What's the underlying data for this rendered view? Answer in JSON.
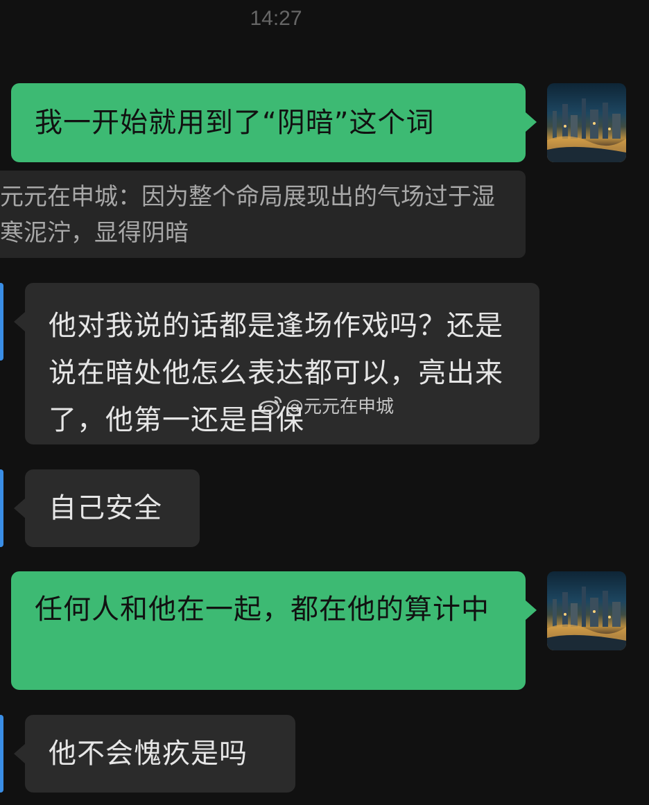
{
  "time": "14:27",
  "colors": {
    "background": "#111111",
    "outgoing_bubble": "#3dba73",
    "incoming_bubble": "#2b2b2b",
    "quote_background": "#262626",
    "avatar_edge": "#3a8ee6"
  },
  "messages": [
    {
      "direction": "outgoing",
      "text": "我一开始就用到了“阴暗”这个词"
    },
    {
      "direction": "quote",
      "text": "元元在申城：因为整个命局展现出的气场过于湿寒泥泞，显得阴暗"
    },
    {
      "direction": "incoming",
      "text": "他对我说的话都是逢场作戏吗？还是说在暗处他怎么表达都可以，亮出来了，他第一还是自保"
    },
    {
      "direction": "incoming",
      "text": "自己安全"
    },
    {
      "direction": "outgoing",
      "text": "任何人和他在一起，都在他的算计中"
    },
    {
      "direction": "incoming",
      "text": "他不会愧疚是吗"
    }
  ],
  "watermark": {
    "icon": "weibo-icon",
    "text": "@元元在申城"
  },
  "avatar": {
    "icon": "city-night-avatar"
  }
}
